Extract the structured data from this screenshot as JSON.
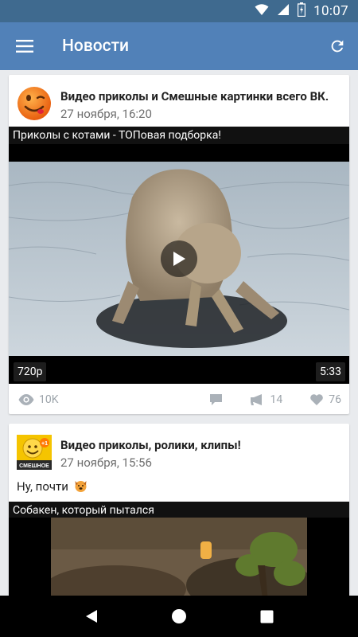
{
  "status_bar": {
    "time": "10:07"
  },
  "app_bar": {
    "title": "Новости"
  },
  "posts": [
    {
      "author": "Видео приколы и Смешные картинки всего ВК.",
      "date": "27 ноября, 16:20",
      "video": {
        "caption": "Приколы с котами - ТОПовая подборка!",
        "quality": "720p",
        "duration": "5:33"
      },
      "stats": {
        "views": "10K",
        "shares": "14",
        "likes": "76"
      }
    },
    {
      "author": "Видео приколы, ролики, клипы!",
      "date": "27 ноября, 15:56",
      "avatar_text": "СМЕШНОЕ",
      "avatar_badge": "+1",
      "text": "Ну, почти",
      "video": {
        "caption": "Собакен, который пытался"
      }
    }
  ],
  "colors": {
    "app_bar": "#5181b8",
    "status_bar": "#3f6a8f",
    "background": "#e9ebee"
  }
}
